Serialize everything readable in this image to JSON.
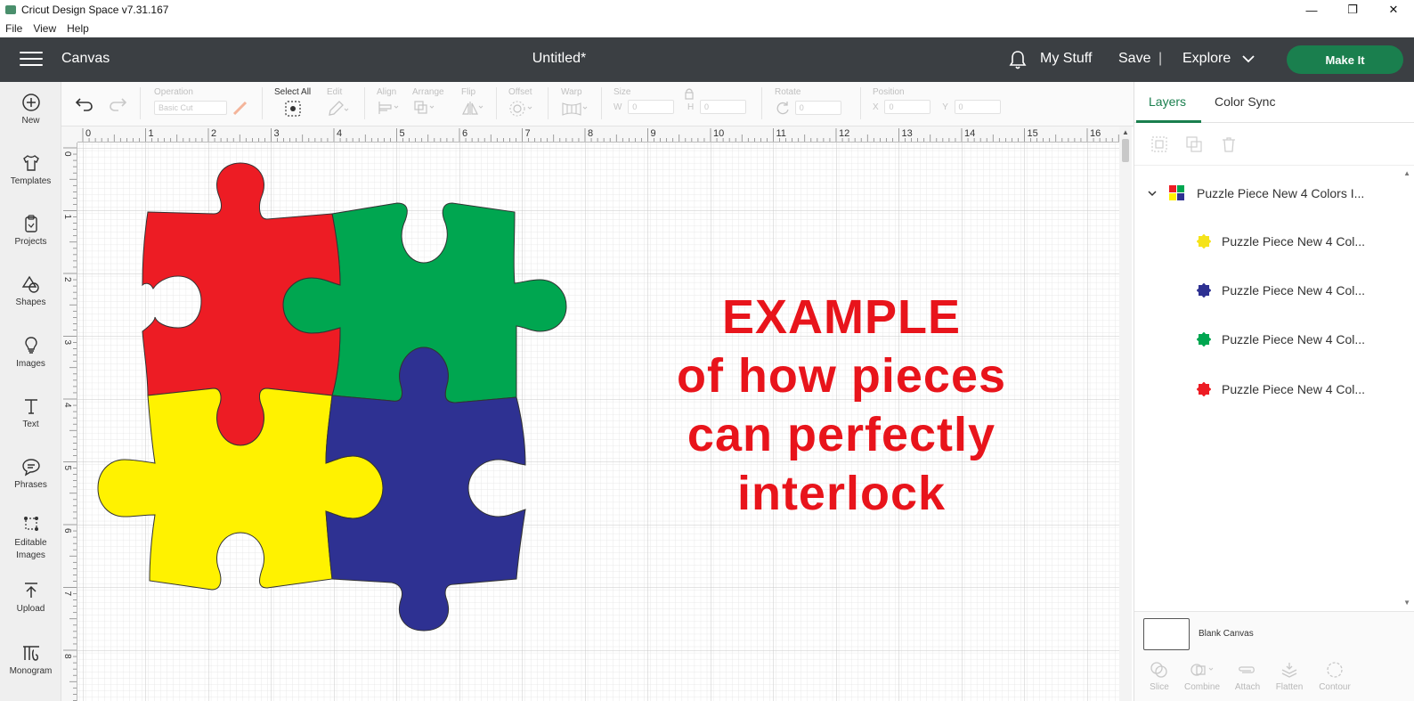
{
  "window": {
    "title": "Cricut Design Space  v7.31.167",
    "minimize": "—",
    "maximize": "❐",
    "close": "✕"
  },
  "menubar": {
    "items": [
      "File",
      "View",
      "Help"
    ]
  },
  "header": {
    "section": "Canvas",
    "doc_title": "Untitled*",
    "my_stuff": "My Stuff",
    "save": "Save",
    "separator": "|",
    "explore": "Explore",
    "make_it": "Make It"
  },
  "leftbar": {
    "items": [
      {
        "label": "New",
        "icon": "plus-circle-icon"
      },
      {
        "label": "Templates",
        "icon": "shirt-icon"
      },
      {
        "label": "Projects",
        "icon": "clipboard-icon"
      },
      {
        "label": "Shapes",
        "icon": "shapes-icon"
      },
      {
        "label": "Images",
        "icon": "lightbulb-icon"
      },
      {
        "label": "Text",
        "icon": "text-icon"
      },
      {
        "label": "Phrases",
        "icon": "speech-bubble-icon"
      },
      {
        "label": "Editable Images",
        "icon": "editable-image-icon"
      },
      {
        "label": "Upload",
        "icon": "upload-icon"
      },
      {
        "label": "Monogram",
        "icon": "monogram-icon"
      }
    ]
  },
  "toolbar": {
    "operation_label": "Operation",
    "operation_value": "Basic Cut",
    "select_all": "Select All",
    "edit": "Edit",
    "align": "Align",
    "arrange": "Arrange",
    "flip": "Flip",
    "offset": "Offset",
    "warp": "Warp",
    "size": "Size",
    "w": "W",
    "h": "H",
    "w_val": "0",
    "h_val": "0",
    "rotate": "Rotate",
    "rotate_val": "0",
    "position": "Position",
    "x": "X",
    "y": "Y",
    "x_val": "0",
    "y_val": "0"
  },
  "ruler": {
    "top": [
      "0",
      "1",
      "2",
      "3",
      "4",
      "5",
      "6",
      "7",
      "8",
      "9",
      "10",
      "11",
      "12",
      "13",
      "14",
      "15",
      "16"
    ],
    "left": [
      "0",
      "1",
      "2",
      "3",
      "4",
      "5",
      "6",
      "7",
      "8"
    ]
  },
  "canvas": {
    "example_lines": [
      "EXAMPLE",
      "of how pieces",
      "can perfectly",
      "interlock"
    ],
    "piece_colors": {
      "red": "#ed1c24",
      "green": "#00a650",
      "yellow": "#fff200",
      "blue": "#2e3192"
    }
  },
  "panel": {
    "tab_layers": "Layers",
    "tab_color_sync": "Color Sync",
    "group_name": "Puzzle Piece New 4 Colors I...",
    "layers": [
      {
        "name": "Puzzle Piece New 4 Col...",
        "color": "#f5e31a"
      },
      {
        "name": "Puzzle Piece New 4 Col...",
        "color": "#2e3192"
      },
      {
        "name": "Puzzle Piece New 4 Col...",
        "color": "#00a650"
      },
      {
        "name": "Puzzle Piece New 4 Col...",
        "color": "#ed1c24"
      }
    ],
    "blank_canvas": "Blank Canvas",
    "bottom_tools": [
      "Slice",
      "Combine",
      "Attach",
      "Flatten",
      "Contour"
    ]
  }
}
